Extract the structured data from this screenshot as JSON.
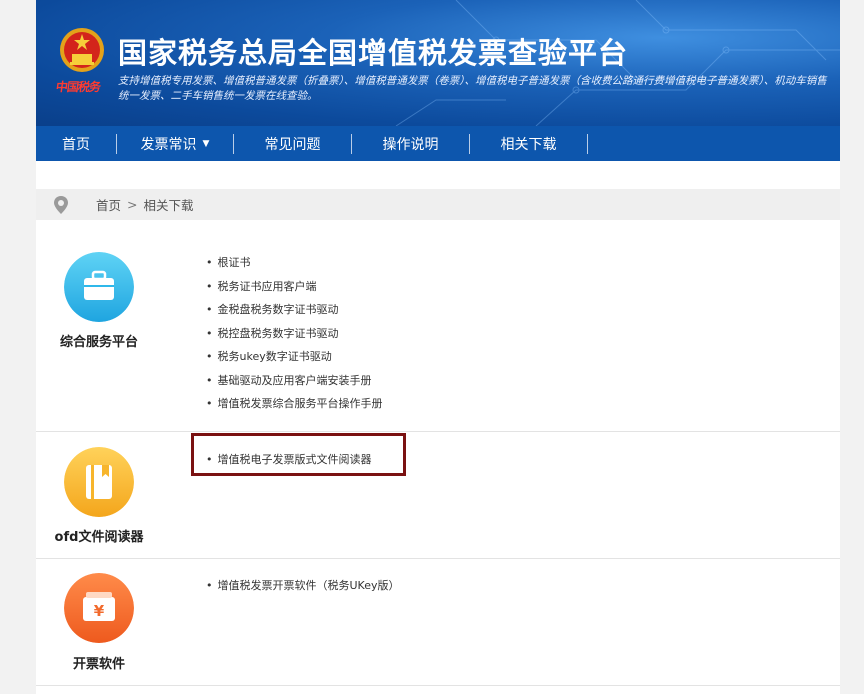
{
  "header": {
    "brand_text": "中国税务",
    "title": "国家税务总局全国增值税发票查验平台",
    "subtitle": "支持增值税专用发票、增值税普通发票（折叠票）、增值税普通发票（卷票）、增值税电子普通发票（含收费公路通行费增值税电子普通发票）、机动车销售统一发票、二手车销售统一发票在线查验。",
    "colors": {
      "accent": "#0d56ad",
      "header_bg": "#1b62b8",
      "brand_red": "#ff3b30"
    }
  },
  "nav": {
    "items": [
      {
        "label": "首页"
      },
      {
        "label": "发票常识",
        "has_dropdown": true
      },
      {
        "label": "常见问题"
      },
      {
        "label": "操作说明"
      },
      {
        "label": "相关下载"
      }
    ]
  },
  "breadcrumb": {
    "home": "首页",
    "separator": ">",
    "current": "相关下载"
  },
  "sections": [
    {
      "title": "综合服务平台",
      "icon": "briefcase-icon",
      "icon_color": "#2fb8ea",
      "items": [
        "根证书",
        "税务证书应用客户端",
        "金税盘税务数字证书驱动",
        "税控盘税务数字证书驱动",
        "税务ukey数字证书驱动",
        "基础驱动及应用客户端安装手册",
        "增值税发票综合服务平台操作手册"
      ]
    },
    {
      "title": "ofd文件阅读器",
      "icon": "book-icon",
      "icon_color": "#f7b52c",
      "items": [
        "增值税电子发票版式文件阅读器"
      ]
    },
    {
      "title": "开票软件",
      "icon": "yuan-wallet-icon",
      "icon_color": "#f26a2c",
      "items": [
        "增值税发票开票软件（税务UKey版）"
      ]
    }
  ],
  "highlight_color": "#7a1111"
}
